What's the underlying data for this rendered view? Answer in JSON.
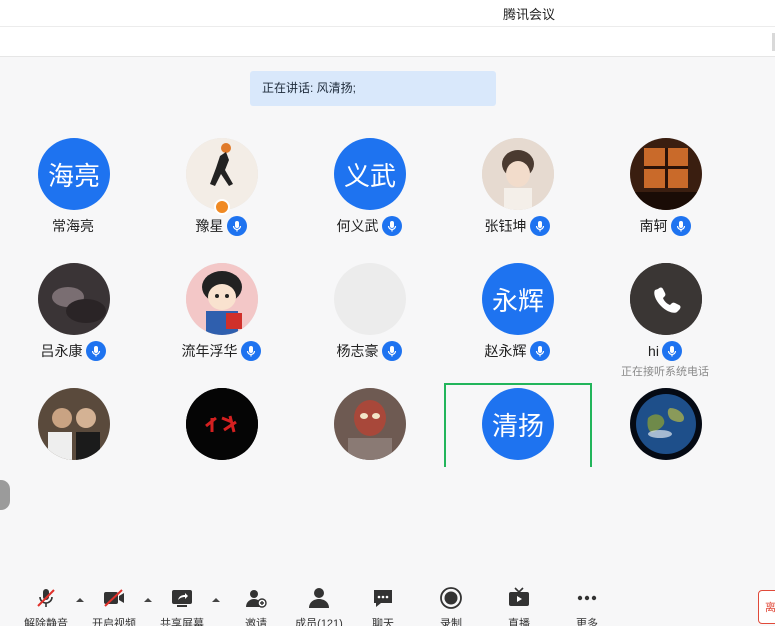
{
  "window": {
    "title": "腾讯会议"
  },
  "speaking": {
    "text": "正在讲话: 风清扬;"
  },
  "participants": [
    {
      "name": "常海亮",
      "avatar_text": "海亮",
      "mic": false
    },
    {
      "name": "豫星",
      "avatar_text": "",
      "mic": true,
      "host": true
    },
    {
      "name": "何义武",
      "avatar_text": "义武",
      "mic": true
    },
    {
      "name": "张钰坤",
      "avatar_text": "",
      "mic": true
    },
    {
      "name": "南轲",
      "avatar_text": "",
      "mic": true
    },
    {
      "name": "吕永康",
      "avatar_text": "",
      "mic": true
    },
    {
      "name": "流年浮华",
      "avatar_text": "",
      "mic": true
    },
    {
      "name": "杨志豪",
      "avatar_text": "",
      "mic": true
    },
    {
      "name": "赵永辉",
      "avatar_text": "永辉",
      "mic": true
    },
    {
      "name": "hi",
      "avatar_text": "",
      "mic": true,
      "status": "正在接听系统电话"
    },
    {
      "name": "",
      "avatar_text": "",
      "mic": false
    },
    {
      "name": "",
      "avatar_text": "",
      "mic": false
    },
    {
      "name": "",
      "avatar_text": "",
      "mic": false
    },
    {
      "name": "",
      "avatar_text": "清扬",
      "mic": false,
      "selected": true
    },
    {
      "name": "",
      "avatar_text": "",
      "mic": false
    }
  ],
  "toolbar": {
    "unmute": "解除静音",
    "start_video": "开启视频",
    "share_screen": "共享屏幕",
    "invite": "邀请",
    "members": "成员(121)",
    "chat": "聊天",
    "record": "录制",
    "live": "直播",
    "more": "更多",
    "end": "离开"
  },
  "colors": {
    "accent": "#1e73f0",
    "selected_border": "#22b55b",
    "speaking_bg": "#d9e8fb",
    "end": "#e04a3a"
  },
  "icons": [
    "mic-muted-icon",
    "video-off-icon",
    "share-screen-icon",
    "invite-icon",
    "members-icon",
    "chat-icon",
    "record-icon",
    "live-icon",
    "more-icon",
    "phone-icon",
    "host-badge-icon"
  ]
}
